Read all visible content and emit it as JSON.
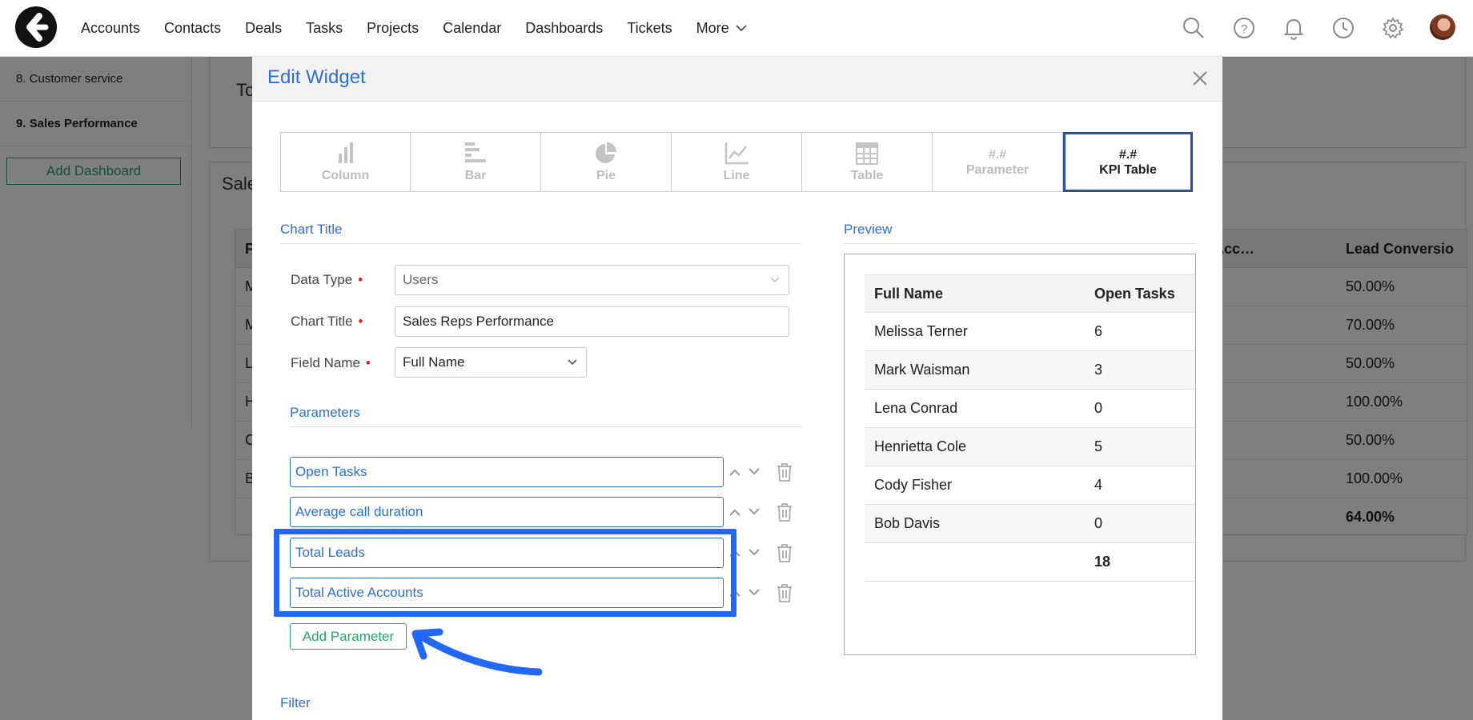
{
  "nav": {
    "items": [
      "Accounts",
      "Contacts",
      "Deals",
      "Tasks",
      "Projects",
      "Calendar",
      "Dashboards",
      "Tickets"
    ],
    "more_label": "More",
    "icons": [
      "search-icon",
      "help-icon",
      "bell-icon",
      "clock-icon",
      "gear-icon"
    ]
  },
  "sidebar": {
    "items": [
      {
        "label": "8. Customer service",
        "active": false
      },
      {
        "label": "9. Sales Performance",
        "active": true
      }
    ],
    "add_dashboard_label": "Add Dashboard"
  },
  "background": {
    "card1_title": "To",
    "card2_title": "Sale",
    "table_header_first": "F",
    "table_header_mid": "Acc…",
    "table_header_last": "Lead Conversio",
    "row_initials": [
      "M",
      "M",
      "L",
      "H",
      "C",
      "B",
      ""
    ],
    "lead_conversion": [
      "50.00%",
      "70.00%",
      "50.00%",
      "100.00%",
      "50.00%",
      "100.00%",
      "64.00%"
    ]
  },
  "modal": {
    "title": "Edit Widget",
    "chart_types": [
      {
        "label": "Column",
        "icon": "column-chart-icon"
      },
      {
        "label": "Bar",
        "icon": "bar-chart-icon"
      },
      {
        "label": "Pie",
        "icon": "pie-chart-icon"
      },
      {
        "label": "Line",
        "icon": "line-chart-icon"
      },
      {
        "label": "Table",
        "icon": "table-icon"
      },
      {
        "hash": "#.#",
        "label": "Parameter"
      },
      {
        "hash": "#.#",
        "label": "KPI Table",
        "selected": true
      }
    ],
    "chart_title_section": "Chart Title",
    "data_type": {
      "label": "Data Type",
      "value": "Users"
    },
    "chart_title_field": {
      "label": "Chart Title",
      "value": "Sales Reps Performance"
    },
    "field_name": {
      "label": "Field Name",
      "value": "Full Name"
    },
    "parameters_section": "Parameters",
    "parameters": [
      "Open Tasks",
      "Average call duration",
      "Total Leads",
      "Total Active Accounts"
    ],
    "add_parameter_label": "Add Parameter",
    "filter_section": "Filter",
    "preview_section": "Preview",
    "preview_table": {
      "headers": [
        "Full Name",
        "Open Tasks"
      ],
      "rows": [
        [
          "Melissa Terner",
          "6"
        ],
        [
          "Mark Waisman",
          "3"
        ],
        [
          "Lena Conrad",
          "0"
        ],
        [
          "Henrietta Cole",
          "5"
        ],
        [
          "Cody Fisher",
          "4"
        ],
        [
          "Bob Davis",
          "0"
        ]
      ],
      "total": "18"
    },
    "colors": {
      "accent_blue": "#2d6fd8",
      "green": "#27a36b",
      "highlight": "#2268f5"
    }
  }
}
